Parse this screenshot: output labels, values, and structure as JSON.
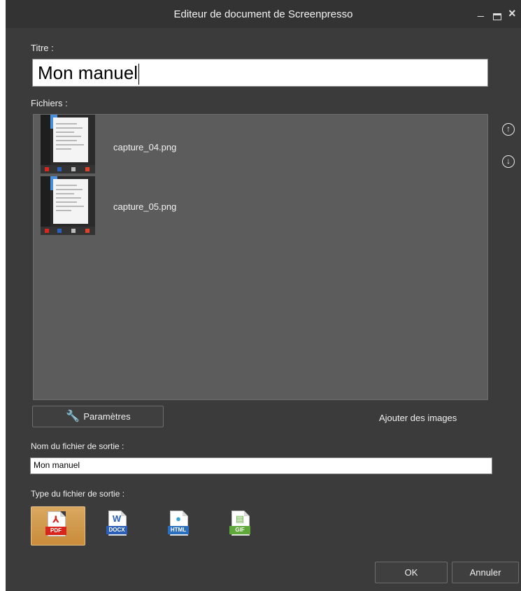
{
  "window": {
    "title": "Editeur de document de Screenpresso",
    "minimize_glyph": "_",
    "close_glyph": "×"
  },
  "title_field": {
    "label": "Titre :",
    "value": "Mon manuel"
  },
  "files": {
    "label": "Fichiers :",
    "items": [
      {
        "name": "capture_04.png"
      },
      {
        "name": "capture_05.png"
      }
    ],
    "move_up_glyph": "↑",
    "move_down_glyph": "↓"
  },
  "actions": {
    "params_label": "Paramètres",
    "wrench_glyph": "🔧",
    "add_images_label": "Ajouter des images"
  },
  "output": {
    "name_label": "Nom du fichier de sortie :",
    "name_value": "Mon manuel",
    "type_label": "Type du fichier de sortie :",
    "types": [
      {
        "label": "PDF",
        "glyph": "⅄",
        "color": "#d9261c",
        "selected": true
      },
      {
        "label": "DOCX",
        "glyph": "W",
        "color": "#2b5fb8",
        "selected": false
      },
      {
        "label": "HTML",
        "glyph": "●",
        "color": "#2b6fbf",
        "selected": false
      },
      {
        "label": "GIF",
        "glyph": "▤",
        "color": "#5fa83a",
        "selected": false
      }
    ]
  },
  "buttons": {
    "ok_label": "OK",
    "cancel_label": "Annuler"
  },
  "colors": {
    "background": "#3b3b3b",
    "panel": "#5c5c5c",
    "selected_type": "#d9a860"
  }
}
